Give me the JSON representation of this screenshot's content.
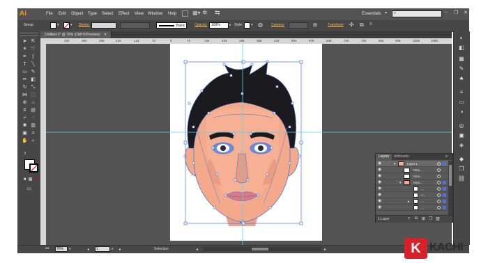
{
  "app": {
    "logo": "Ai"
  },
  "menu": [
    "File",
    "Edit",
    "Object",
    "Type",
    "Select",
    "Effect",
    "View",
    "Window",
    "Help"
  ],
  "workspace": {
    "label": "Essentials",
    "search_placeholder": ""
  },
  "window_controls": {
    "minimize": "–",
    "restore": "❐",
    "close": "✕"
  },
  "options": {
    "selection": "Group",
    "stroke_label": "Stroke:",
    "brush_label": "Basic",
    "opacity_label": "Opacity:",
    "opacity_value": "100%",
    "style_label": "Style:",
    "camera_label": "Camera:",
    "transform_label": "Transform"
  },
  "document": {
    "tab": "Untitled-1* @ 76% (CMYK/Preview)",
    "close": "✕"
  },
  "ruler_h": [
    "432",
    "360",
    "288",
    "216",
    "144",
    "72",
    "0",
    "72",
    "144",
    "216",
    "288",
    "360",
    "432",
    "504",
    "576",
    "648",
    "720",
    "792",
    "864",
    "936",
    "1008",
    "1080"
  ],
  "status": {
    "zoom": "76%",
    "page": "1",
    "mode": "Selection"
  },
  "layers": {
    "tab_active": "Layers",
    "tab_other": "Artboards",
    "rows": [
      "Layer 1",
      "<Gui...",
      "<Gui...",
      "<Gro...",
      "...",
      "<...",
      "...",
      "..."
    ],
    "footer": "1 Layer"
  },
  "brand": {
    "badge": "K",
    "name": "KACHI"
  },
  "colors": {
    "accent_orange": "#ff9a00",
    "selection_blue": "#4a74d8",
    "guide_cyan": "#54d4f0",
    "skin": "#f4a98a",
    "hair": "#1b1b1f"
  }
}
